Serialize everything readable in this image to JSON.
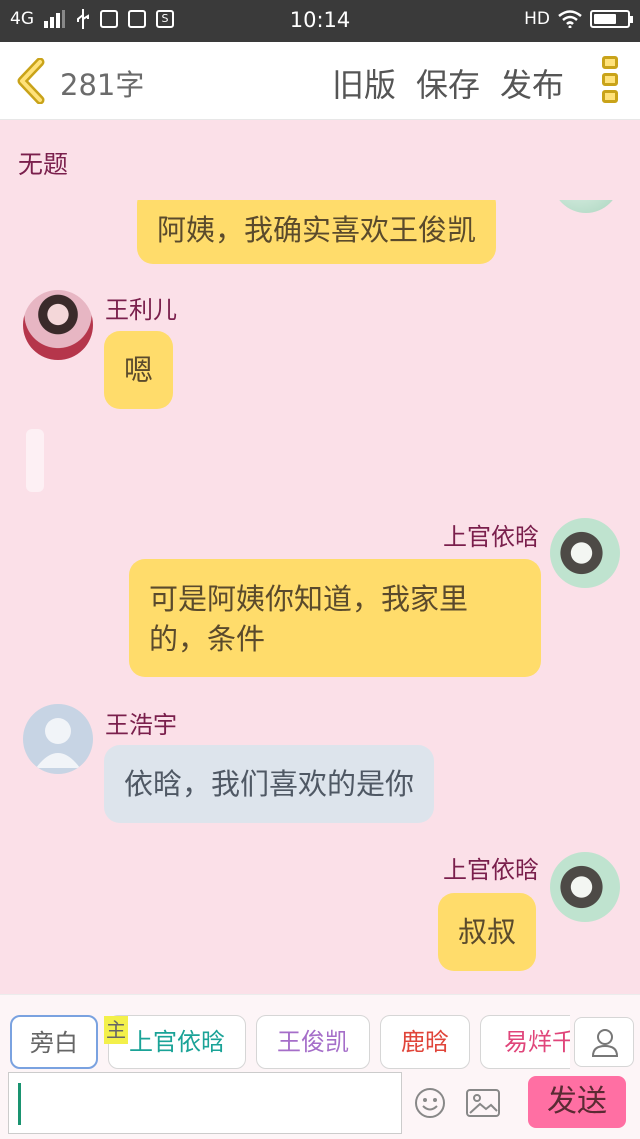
{
  "status_bar": {
    "network": "4G",
    "time": "10:14",
    "hd": "HD",
    "icon_s": "S"
  },
  "header": {
    "word_count": "281字",
    "actions": [
      "旧版",
      "保存",
      "发布"
    ]
  },
  "page_title": "无题",
  "messages": [
    {
      "text": "阿姨，我确实喜欢王俊凯"
    },
    {
      "sender": "王利儿",
      "text": "嗯"
    },
    {
      "sender": "上官依晗",
      "text_lines": [
        "可是阿姨你知道，我家里",
        "的，条件"
      ]
    },
    {
      "sender": "王浩宇",
      "text": "依晗，我们喜欢的是你"
    },
    {
      "sender": "上官依晗",
      "text": "叔叔"
    }
  ],
  "characters": [
    {
      "name": "旁白",
      "color": "#666666"
    },
    {
      "name": "上官依晗",
      "color": "#1aa397"
    },
    {
      "name": "王俊凯",
      "color": "#a56ec9"
    },
    {
      "name": "鹿晗",
      "color": "#e0453a"
    },
    {
      "name": "易烊千",
      "color": "#e0457a"
    }
  ],
  "owner_mark": "主",
  "send_label": "发送",
  "colors": {
    "accent_yellow": "#ffdc6b",
    "background_pink": "#fbe0e8",
    "send_pink": "#ff6fa3"
  }
}
